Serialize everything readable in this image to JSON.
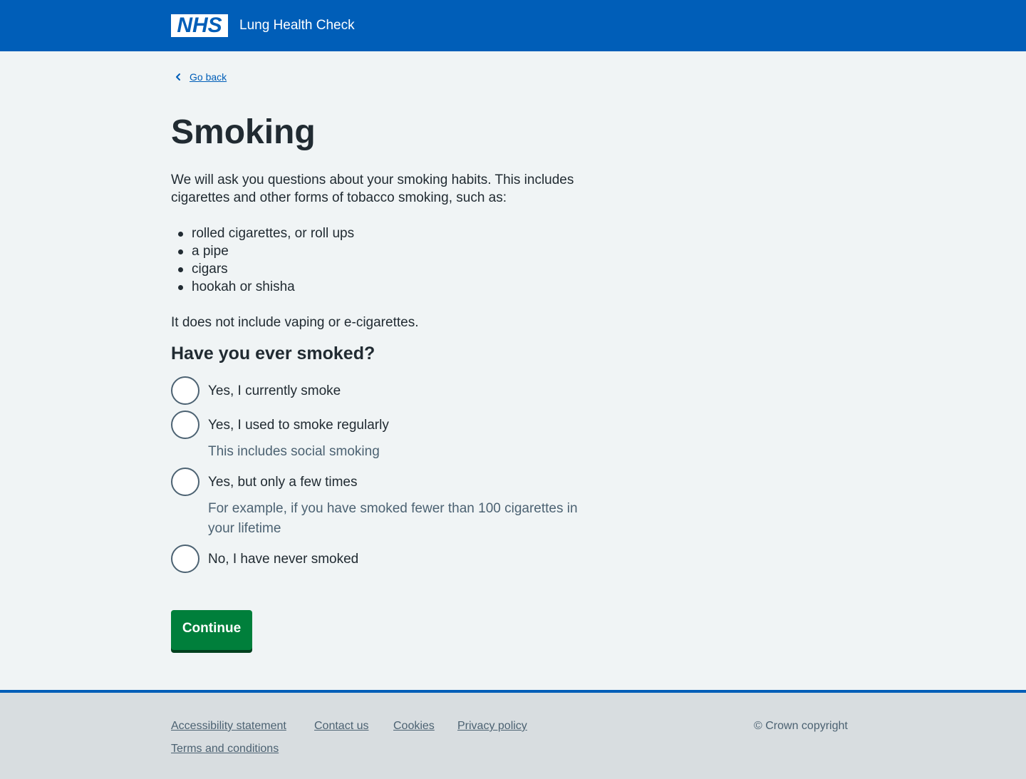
{
  "header": {
    "logo_text": "NHS",
    "service_name": "Lung Health Check",
    "background_color": "#005eb8"
  },
  "nav": {
    "back_icon": "chevron-left-icon",
    "back_label": "Go back"
  },
  "main": {
    "title": "Smoking",
    "intro": "We will ask you questions about your smoking habits. This includes cigarettes and other forms of tobacco smoking, such as:",
    "bullets": [
      "rolled cigarettes, or roll ups",
      "a pipe",
      "cigars",
      "hookah or shisha"
    ],
    "note": "It does not include vaping or e-cigarettes.",
    "question": "Have you ever smoked?",
    "options": [
      {
        "label": "Yes, I currently smoke",
        "hint": "",
        "checked": false
      },
      {
        "label": "Yes, I used to smoke regularly",
        "hint": "This includes social smoking",
        "checked": false
      },
      {
        "label": "Yes, but only a few times",
        "hint": "For example, if you have smoked fewer than 100 cigarettes in your lifetime",
        "checked": false
      },
      {
        "label": "No, I have never smoked",
        "hint": "",
        "checked": false
      }
    ],
    "continue_label": "Continue",
    "button_color": "#007f3b"
  },
  "footer": {
    "links": [
      "Accessibility statement",
      "Contact us",
      "Cookies",
      "Privacy policy",
      "Terms and conditions"
    ],
    "copyright": "© Crown copyright"
  }
}
